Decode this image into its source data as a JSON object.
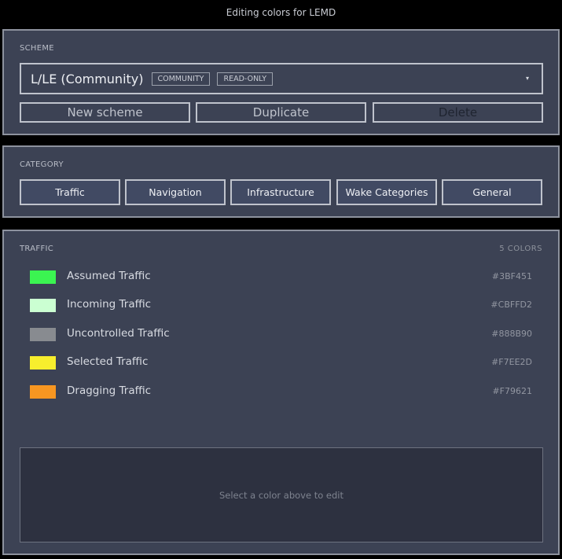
{
  "window": {
    "title": "Editing colors for LEMD"
  },
  "scheme": {
    "section_label": "SCHEME",
    "selected_name": "L/LE (Community)",
    "tags": [
      "COMMUNITY",
      "READ-ONLY"
    ],
    "dropdown_arrow": "▾",
    "buttons": {
      "new": "New scheme",
      "duplicate": "Duplicate",
      "delete": "Delete"
    }
  },
  "category": {
    "section_label": "CATEGORY",
    "items": [
      "Traffic",
      "Navigation",
      "Infrastructure",
      "Wake Categories",
      "General"
    ]
  },
  "traffic": {
    "section_label": "TRAFFIC",
    "count_label": "5 COLORS",
    "colors": [
      {
        "name": "Assumed Traffic",
        "hex": "#3BF451"
      },
      {
        "name": "Incoming Traffic",
        "hex": "#CBFFD2"
      },
      {
        "name": "Uncontrolled Traffic",
        "hex": "#888B90"
      },
      {
        "name": "Selected Traffic",
        "hex": "#F7EE2D"
      },
      {
        "name": "Dragging Traffic",
        "hex": "#F79621"
      }
    ],
    "editor_hint": "Select a color above to edit"
  }
}
